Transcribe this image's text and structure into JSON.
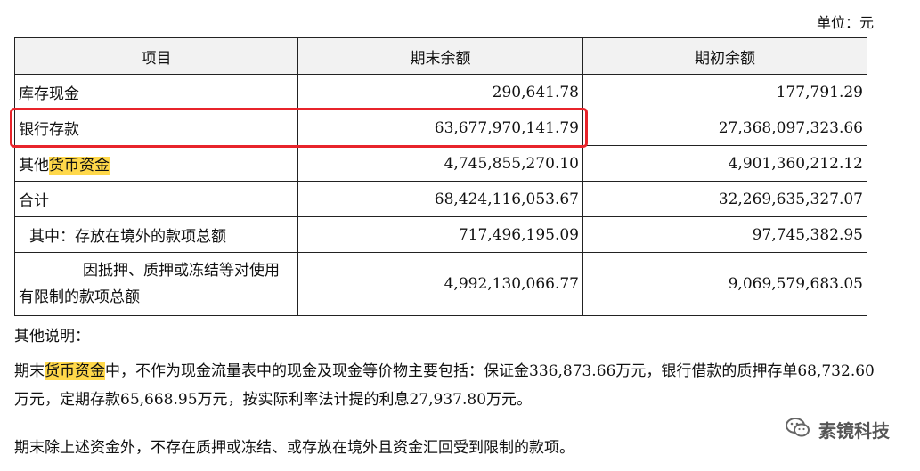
{
  "unit": "单位：元",
  "table": {
    "headers": [
      "项目",
      "期末余额",
      "期初余额"
    ],
    "rows": [
      {
        "label": "库存现金",
        "end": "290,641.78",
        "begin": "177,791.29"
      },
      {
        "label": "银行存款",
        "end": "63,677,970,141.79",
        "begin": "27,368,097,323.66"
      },
      {
        "label_prefix": "其他",
        "label_highlight": "货币资金",
        "end": "4,745,855,270.10",
        "begin": "4,901,360,212.12"
      },
      {
        "label": "合计",
        "end": "68,424,116,053.67",
        "begin": "32,269,635,327.07"
      },
      {
        "label": "其中：存放在境外的款项总额",
        "end": "717,496,195.09",
        "begin": "97,745,382.95"
      },
      {
        "label_line1": "因抵押、质押或冻结等对使用",
        "label_line2": "有限制的款项总额",
        "end": "4,992,130,066.77",
        "begin": "9,069,579,683.05"
      }
    ]
  },
  "notes": {
    "title": "其他说明：",
    "para1_prefix": "期末",
    "para1_highlight": "货币资金",
    "para1_rest": "中，不作为现金流量表中的现金及现金等价物主要包括：保证金336,873.66万元，银行借款的质押存单68,732.60万元，定期存款65,668.95万元，按实际利率法计提的利息27,937.80万元。",
    "para2": "期末除上述资金外，不存在质押或冻结、或存放在境外且资金汇回受到限制的款项。"
  },
  "watermark": {
    "text": "素镜科技",
    "icon": "wechat-icon"
  },
  "colors": {
    "highlight": "#ffd84a",
    "red_box": "#e8242b",
    "header_bg": "#f2f2f2"
  }
}
